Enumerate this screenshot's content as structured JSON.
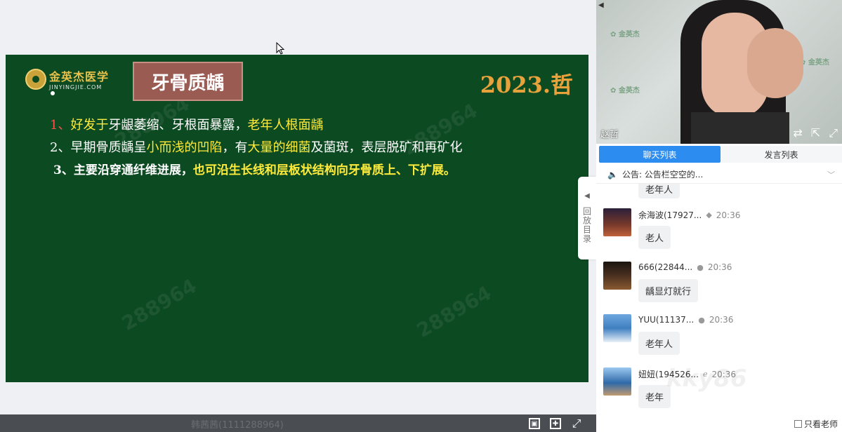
{
  "slide": {
    "logo_cn": "金英杰医学",
    "logo_en": "JINYINGJIE.COM",
    "title": "牙骨质龋",
    "year": "2023.哲",
    "line1": {
      "num": "1、",
      "a": "好发于",
      "b": "牙龈萎缩、牙根面暴露，",
      "c": "老年人根面龋"
    },
    "line2": {
      "a": "2、早期骨质龋呈",
      "b": "小而浅的凹陷",
      "c": "，有",
      "d": "大量的细菌",
      "e": "及菌斑，表层脱矿和再矿化"
    },
    "line3": {
      "a": "3、主要沿穿通纤维进展，",
      "b": "也可沿生长线和层板状结构向牙骨质上、下扩展。"
    },
    "watermark": "288964"
  },
  "bottom_bar": {
    "user_id": "韩茜茜(1111288964)"
  },
  "replay_tab": {
    "label": "回放目录"
  },
  "video": {
    "speaker": "赵哲"
  },
  "tabs": {
    "chat": "聊天列表",
    "speakers": "发言列表"
  },
  "notice": {
    "text": "公告: 公告栏空空的..."
  },
  "partial_message": "老年人",
  "messages": [
    {
      "name": "余海波(17927...",
      "device": "android-icon",
      "time": "20:36",
      "text": "老人",
      "avatar_color": "#7a3a2a"
    },
    {
      "name": "666(22844...",
      "device": "apple-icon",
      "time": "20:36",
      "text": "龋显灯就行",
      "avatar_color": "#4a3020"
    },
    {
      "name": "YUU(11137...",
      "device": "apple-icon",
      "time": "20:36",
      "text": "老年人",
      "avatar_color": "#3f7fc0"
    },
    {
      "name": "妞妞(194526...",
      "device": "ie-icon",
      "time": "20:36",
      "text": "老年",
      "avatar_color": "#2f6aa8"
    }
  ],
  "only_teacher": "只看老师",
  "bg_watermark": "kky86"
}
